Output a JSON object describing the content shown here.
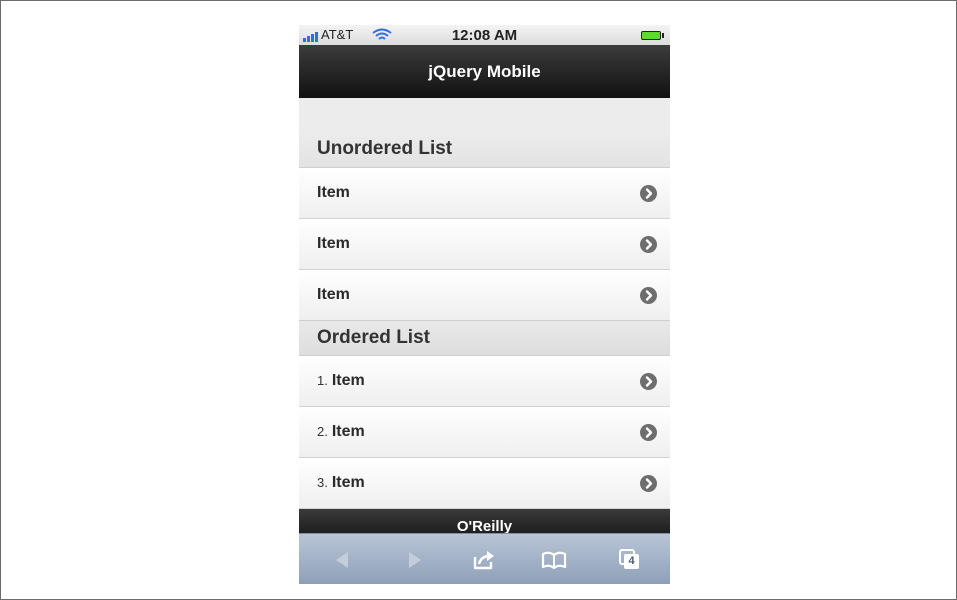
{
  "status_bar": {
    "carrier": "AT&T",
    "time": "12:08 AM"
  },
  "header": {
    "title": "jQuery Mobile"
  },
  "unordered_list": {
    "heading": "Unordered List",
    "items": [
      {
        "label": "Item"
      },
      {
        "label": "Item"
      },
      {
        "label": "Item"
      }
    ]
  },
  "ordered_list": {
    "heading": "Ordered List",
    "items": [
      {
        "number": "1.",
        "label": "Item"
      },
      {
        "number": "2.",
        "label": "Item"
      },
      {
        "number": "3.",
        "label": "Item"
      }
    ]
  },
  "footer": {
    "title": "O'Reilly"
  },
  "toolbar": {
    "buttons": [
      "back-icon",
      "forward-icon",
      "share-icon",
      "bookmarks-icon",
      "tabs-icon"
    ],
    "tabs_count": "4"
  },
  "colors": {
    "header_bg": "#1c1c1c",
    "toolbar_bg": "#a3b1c6",
    "arrow_bg": "#6e6e6e"
  }
}
